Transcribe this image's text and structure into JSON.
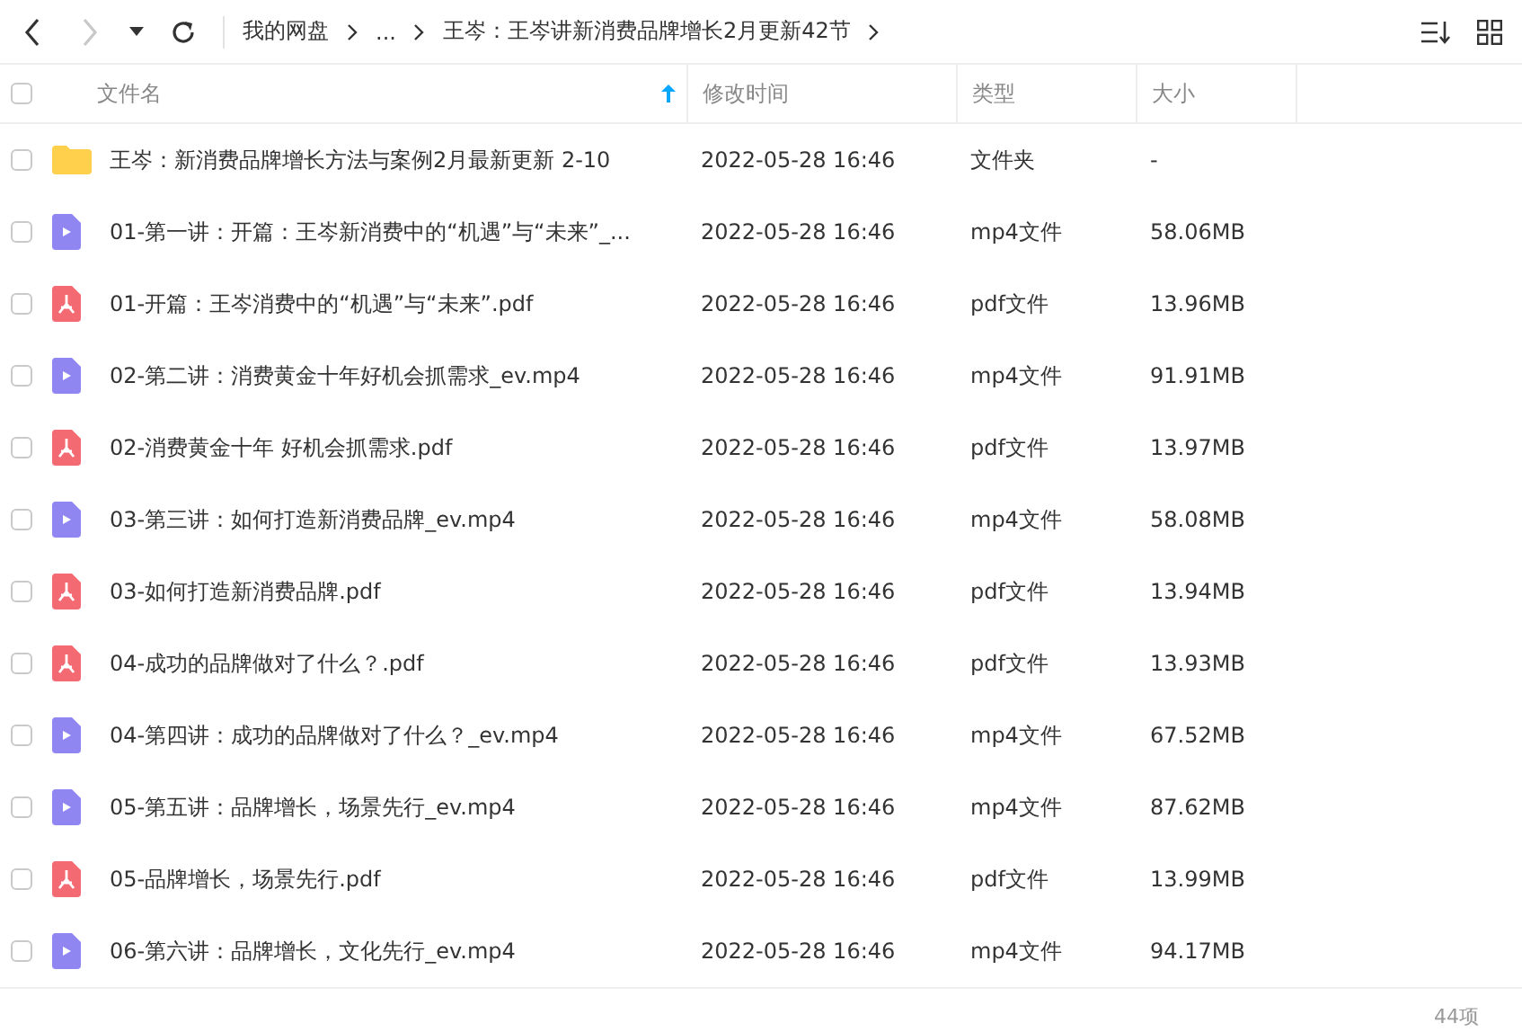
{
  "toolbar": {
    "back_disabled": false,
    "forward_disabled": true,
    "breadcrumb": [
      {
        "label": "我的网盘"
      },
      {
        "label": "..."
      },
      {
        "label": "王岑：王岑讲新消费品牌增长2月更新42节"
      }
    ]
  },
  "table": {
    "select_all_checked": false,
    "columns": [
      {
        "label": "文件名",
        "sorted": true
      },
      {
        "label": "修改时间",
        "sorted": false
      },
      {
        "label": "类型",
        "sorted": false
      },
      {
        "label": "大小",
        "sorted": false
      }
    ],
    "rows": [
      {
        "kind": "folder",
        "name": "王岑：新消费品牌增长方法与案例2月最新更新 2-10",
        "modified": "2022-05-28 16:46",
        "type": "文件夹",
        "size": "-",
        "checked": false
      },
      {
        "kind": "video",
        "name": "01-第一讲：开篇：王岑新消费中的“机遇”与“未来”_...",
        "modified": "2022-05-28 16:46",
        "type": "mp4文件",
        "size": "58.06MB",
        "checked": false
      },
      {
        "kind": "pdf",
        "name": "01-开篇：王岑消费中的“机遇”与“未来”.pdf",
        "modified": "2022-05-28 16:46",
        "type": "pdf文件",
        "size": "13.96MB",
        "checked": false
      },
      {
        "kind": "video",
        "name": "02-第二讲：消费黄金十年好机会抓需求_ev.mp4",
        "modified": "2022-05-28 16:46",
        "type": "mp4文件",
        "size": "91.91MB",
        "checked": false
      },
      {
        "kind": "pdf",
        "name": "02-消费黄金十年 好机会抓需求.pdf",
        "modified": "2022-05-28 16:46",
        "type": "pdf文件",
        "size": "13.97MB",
        "checked": false
      },
      {
        "kind": "video",
        "name": "03-第三讲：如何打造新消费品牌_ev.mp4",
        "modified": "2022-05-28 16:46",
        "type": "mp4文件",
        "size": "58.08MB",
        "checked": false
      },
      {
        "kind": "pdf",
        "name": "03-如何打造新消费品牌.pdf",
        "modified": "2022-05-28 16:46",
        "type": "pdf文件",
        "size": "13.94MB",
        "checked": false
      },
      {
        "kind": "pdf",
        "name": "04-成功的品牌做对了什么？.pdf",
        "modified": "2022-05-28 16:46",
        "type": "pdf文件",
        "size": "13.93MB",
        "checked": false
      },
      {
        "kind": "video",
        "name": "04-第四讲：成功的品牌做对了什么？_ev.mp4",
        "modified": "2022-05-28 16:46",
        "type": "mp4文件",
        "size": "67.52MB",
        "checked": false
      },
      {
        "kind": "video",
        "name": "05-第五讲：品牌增长，场景先行_ev.mp4",
        "modified": "2022-05-28 16:46",
        "type": "mp4文件",
        "size": "87.62MB",
        "checked": false
      },
      {
        "kind": "pdf",
        "name": "05-品牌增长，场景先行.pdf",
        "modified": "2022-05-28 16:46",
        "type": "pdf文件",
        "size": "13.99MB",
        "checked": false
      },
      {
        "kind": "video",
        "name": "06-第六讲：品牌增长，文化先行_ev.mp4",
        "modified": "2022-05-28 16:46",
        "type": "mp4文件",
        "size": "94.17MB",
        "checked": false
      }
    ]
  },
  "status_bar": {
    "count": "44项"
  }
}
